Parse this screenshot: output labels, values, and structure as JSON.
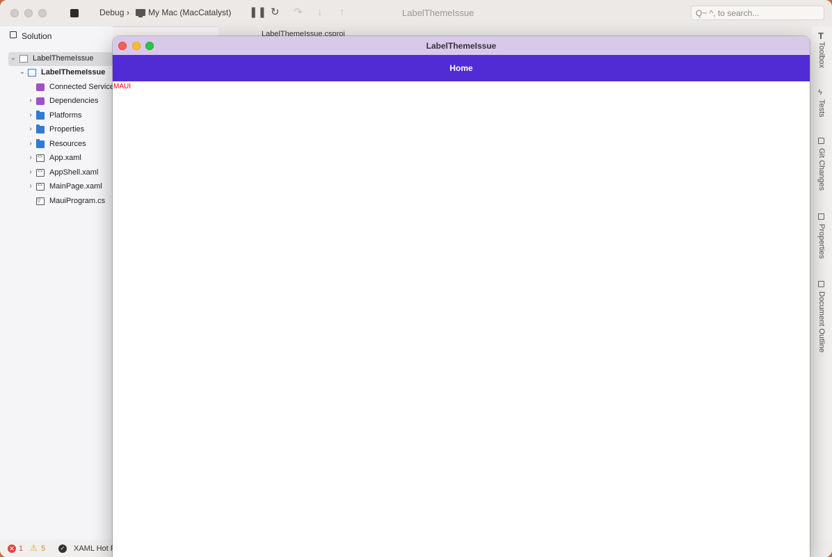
{
  "ide": {
    "title": "LabelThemeIssue",
    "toolbar": {
      "configuration": "Debug",
      "separator": "›",
      "device": "My Mac (MacCatalyst)",
      "search_placeholder": "Q~ ^, to search..."
    },
    "icons": {
      "pause": "pause-icon",
      "restart": "restart-icon",
      "step_over": "step-over-icon",
      "step_into": "step-into-icon",
      "step_out": "step-out-icon"
    }
  },
  "solution": {
    "header": "Solution",
    "items": [
      {
        "label": "LabelThemeIssue"
      },
      {
        "label": "LabelThemeIssue"
      },
      {
        "label": "Connected Services"
      },
      {
        "label": "Dependencies"
      },
      {
        "label": "Platforms"
      },
      {
        "label": "Properties"
      },
      {
        "label": "Resources"
      },
      {
        "label": "App.xaml"
      },
      {
        "label": "AppShell.xaml"
      },
      {
        "label": "MainPage.xaml"
      },
      {
        "label": "MauiProgram.cs"
      }
    ]
  },
  "editor": {
    "tab_label": "LabelThemeIssue.csproj"
  },
  "right_panels": {
    "toolbox": "Toolbox",
    "tests": "Tests",
    "git_changes": "Git Changes",
    "properties": "Properties",
    "document_outline": "Document Outline"
  },
  "status": {
    "errors": "1",
    "warnings": "5",
    "hot_reload": "XAML Hot R"
  },
  "app": {
    "window_title": "LabelThemeIssue",
    "nav_title": "Home",
    "label_text": "MAUI"
  },
  "colors": {
    "nav_bar": "#512bd4",
    "app_titlebar": "#d9c9e8",
    "label": "#ff0000"
  }
}
